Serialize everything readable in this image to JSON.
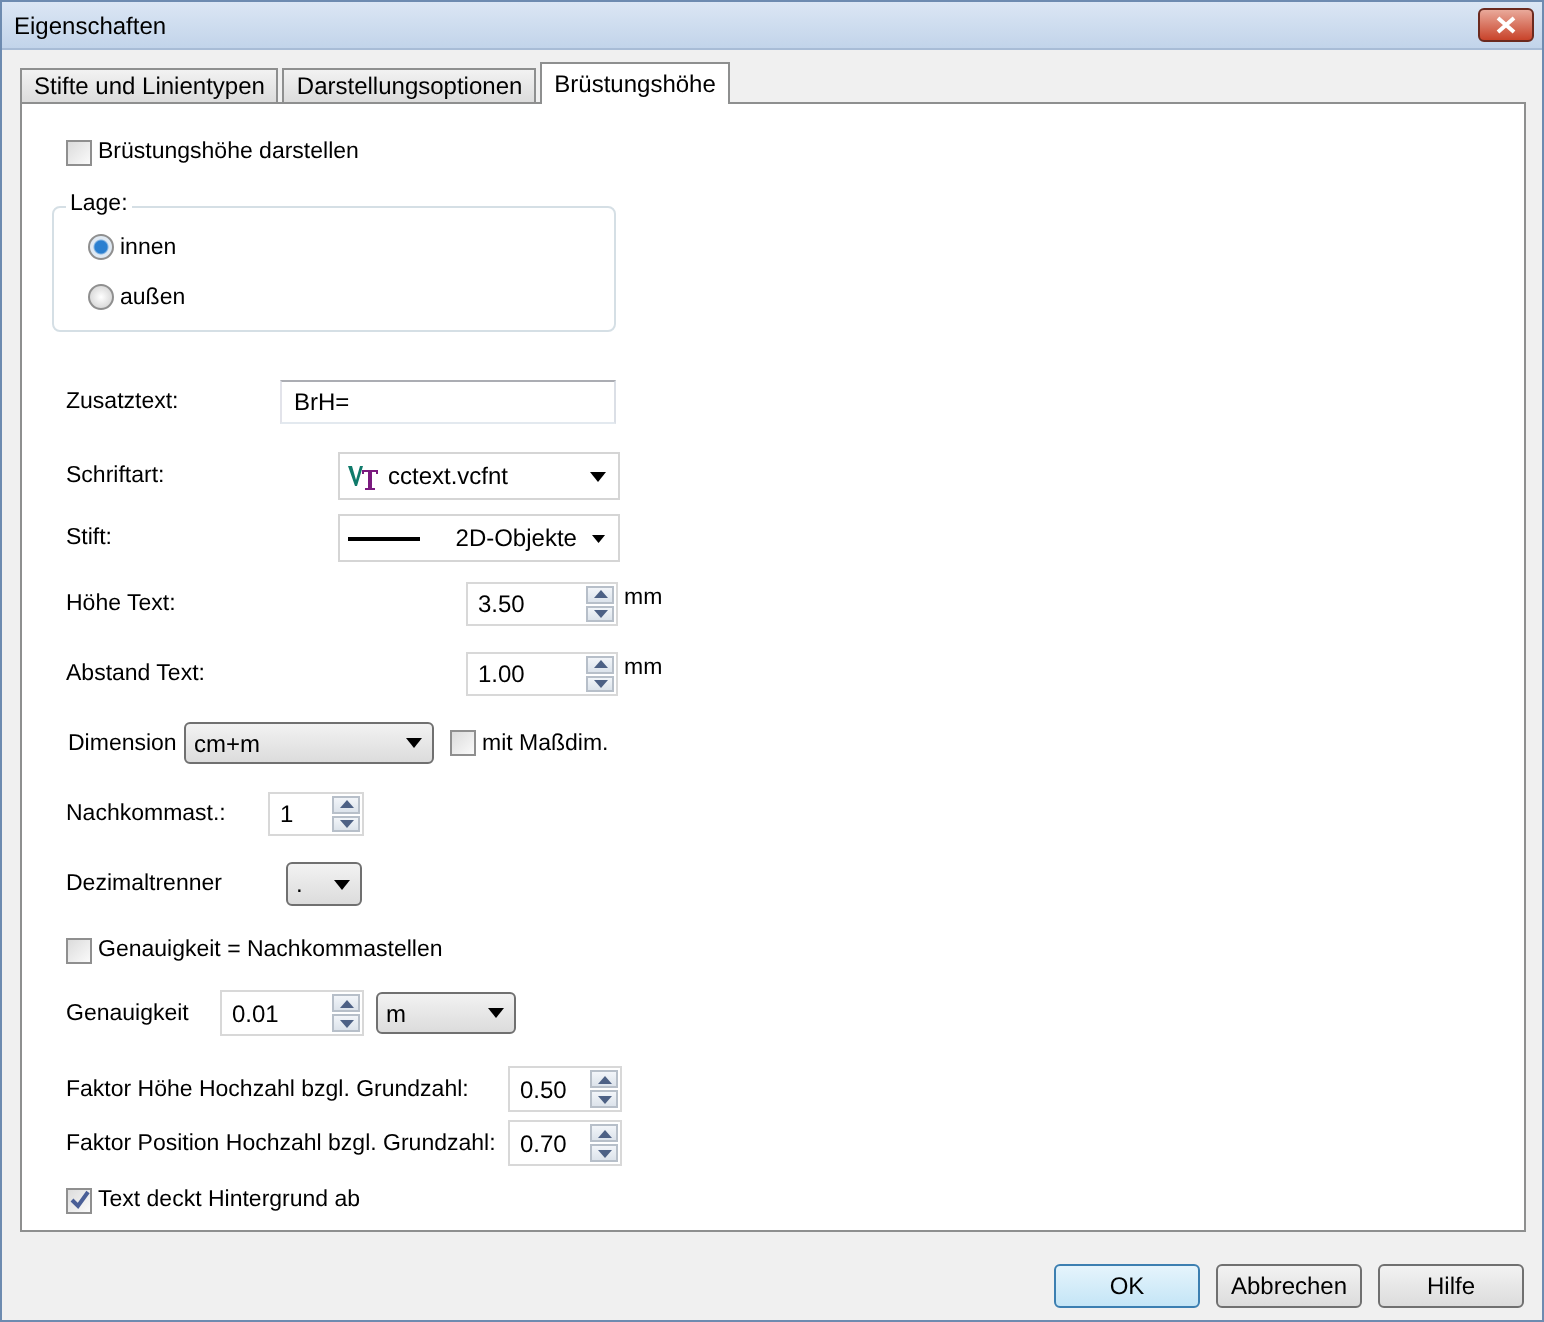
{
  "window": {
    "title": "Eigenschaften"
  },
  "tabs": [
    {
      "label": "Stifte und Linientypen",
      "selected": false
    },
    {
      "label": "Darstellungsoptionen",
      "selected": false
    },
    {
      "label": "Brüstungshöhe",
      "selected": true
    }
  ],
  "form": [
    {
      "kind": "checkbox",
      "label": "Brüstungshöhe darstellen",
      "checked": false
    },
    {
      "kind": "radio_group",
      "legend": "Lage:",
      "options": [
        {
          "label": "innen",
          "selected": true
        },
        {
          "label": "außen",
          "selected": false
        }
      ]
    },
    {
      "kind": "text",
      "label": "Zusatztext:",
      "value": "BrH="
    },
    {
      "kind": "font_combo",
      "label": "Schriftart:",
      "value": "cctext.vcfnt"
    },
    {
      "kind": "pen_combo",
      "label": "Stift:",
      "value": "2D-Objekte"
    },
    {
      "kind": "spin",
      "label": "Höhe Text:",
      "value": "3.50",
      "unit": "mm"
    },
    {
      "kind": "spin",
      "label": "Abstand Text:",
      "value": "1.00",
      "unit": "mm"
    },
    {
      "kind": "combo",
      "label": "Dimension",
      "value": "cm+m",
      "checkbox": {
        "label": "mit Maßdim.",
        "checked": false
      }
    },
    {
      "kind": "spin",
      "label": "Nachkommast.:",
      "value": "1"
    },
    {
      "kind": "combo",
      "label": "Dezimaltrenner",
      "value": "."
    },
    {
      "kind": "checkbox",
      "label": "Genauigkeit = Nachkommastellen",
      "checked": false
    },
    {
      "kind": "spin",
      "label": "Genauigkeit",
      "value": "0.01",
      "combo": "m"
    },
    {
      "kind": "spin",
      "label": "Faktor Höhe Hochzahl bzgl. Grundzahl:",
      "value": "0.50"
    },
    {
      "kind": "spin",
      "label": "Faktor Position Hochzahl bzgl. Grundzahl:",
      "value": "0.70"
    },
    {
      "kind": "checkbox",
      "label": "Text deckt Hintergrund ab",
      "checked": true
    }
  ],
  "buttons": [
    {
      "label": "OK",
      "default": true
    },
    {
      "label": "Abbrechen",
      "default": false
    },
    {
      "label": "Hilfe",
      "default": false
    }
  ]
}
